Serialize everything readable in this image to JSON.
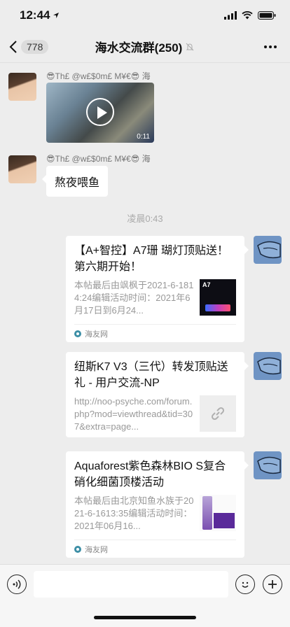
{
  "status_bar": {
    "time": "12:44"
  },
  "nav": {
    "back_badge": "778",
    "title": "海水交流群(250)"
  },
  "messages": [
    {
      "sender": "😎Th£ @w£$0m£ M¥€😎 海",
      "type": "video",
      "duration": "0:11"
    },
    {
      "sender": "😎Th£ @w£$0m£ M¥€😎 海",
      "type": "text",
      "text": "熬夜喂鱼"
    }
  ],
  "timestamp": "凌晨0:43",
  "link_cards": [
    {
      "title": "【A+智控】A7珊 瑚灯顶贴送！第六期开始！",
      "desc": "本帖最后由飒枫于2021-6-1814:24编辑活动时间：2021年6月17日到6月24...",
      "thumb_label": "A7",
      "source": "海友网"
    },
    {
      "title": "纽斯K7 V3（三代）转发顶贴送礼 - 用户交流-NP",
      "desc": "http://noo-psyche.com/forum.php?mod=viewthread&tid=307&extra=page...",
      "source": ""
    },
    {
      "title": "Aquaforest紫色森林BIO S复合硝化细菌顶楼活动",
      "desc": "本帖最后由北京知鱼水族于2021-6-1613:35编辑活动时间：2021年06月16...",
      "source": "海友网"
    }
  ],
  "colors": {
    "background": "#ededed",
    "bubble": "#ffffff",
    "muted_text": "#999999",
    "avatar_right": "#6f94c4"
  }
}
